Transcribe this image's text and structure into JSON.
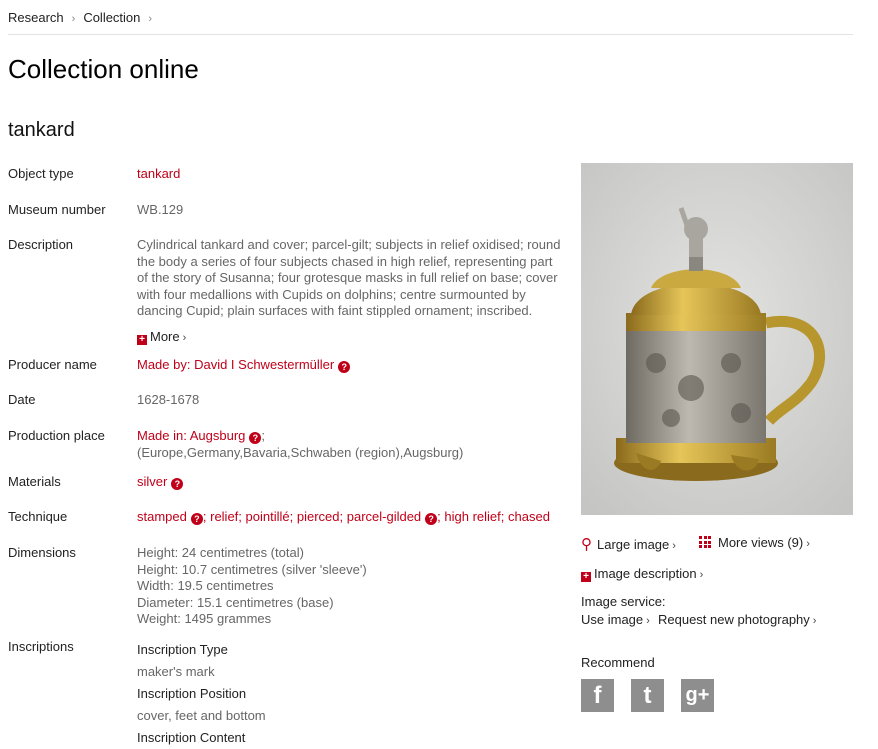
{
  "breadcrumb": [
    {
      "label": "Research"
    },
    {
      "label": "Collection"
    }
  ],
  "page_title": "Collection online",
  "object_title": "tankard",
  "fields": {
    "object_type": {
      "label": "Object type",
      "value": "tankard"
    },
    "museum_number": {
      "label": "Museum number",
      "value": "WB.129"
    },
    "description": {
      "label": "Description",
      "lines": [
        "Cylindrical tankard and cover; parcel-gilt; subjects in relief oxidised; round",
        "the body a series of four subjects chased in high relief, representing part",
        "of the story of Susanna; four grotesque masks in full relief on base; cover",
        "with four medallions with Cupids on dolphins; centre surmounted by",
        "dancing Cupid; plain surfaces with faint stippled ornament; inscribed."
      ],
      "more": "More"
    },
    "producer": {
      "label": "Producer name",
      "value": "Made by: David I Schwestermüller"
    },
    "date": {
      "label": "Date",
      "value": "1628-1678"
    },
    "production_place": {
      "label": "Production place",
      "value": "Made in: Augsburg",
      "suffix": ";",
      "hierarchy": "(Europe,Germany,Bavaria,Schwaben (region),Augsburg)"
    },
    "materials": {
      "label": "Materials",
      "value": "silver"
    },
    "technique": {
      "label": "Technique",
      "items": [
        "stamped",
        "relief",
        "pointillé",
        "pierced",
        "parcel-gilded",
        "high relief",
        "chased"
      ]
    },
    "dimensions": {
      "label": "Dimensions",
      "lines": [
        "Height: 24 centimetres (total)",
        "Height: 10.7 centimetres (silver 'sleeve')",
        "Width: 19.5 centimetres",
        "Diameter: 15.1 centimetres (base)",
        "Weight: 1495 grammes"
      ]
    },
    "inscriptions": {
      "label": "Inscriptions",
      "entries": [
        {
          "heading": "Inscription Type",
          "value": "maker's mark"
        },
        {
          "heading": "Inscription Position",
          "value": "cover, feet and bottom"
        },
        {
          "heading": "Inscription Content",
          "value": ""
        }
      ]
    }
  },
  "image_panel": {
    "large_image": "Large image",
    "more_views": "More views (9)",
    "image_description": "Image description",
    "image_service_label": "Image service:",
    "use_image": "Use image",
    "request_photo": "Request new photography",
    "recommend": "Recommend",
    "social": [
      {
        "icon": "facebook-icon",
        "glyph": "f"
      },
      {
        "icon": "twitter-icon",
        "glyph": "t"
      },
      {
        "icon": "google-plus-icon",
        "glyph": "g+"
      }
    ]
  },
  "colors": {
    "link": "#c00018",
    "muted": "#666666",
    "photo_bg": "#d6d6d4",
    "gold": "#c9a227",
    "silver": "#a9a6a0"
  }
}
